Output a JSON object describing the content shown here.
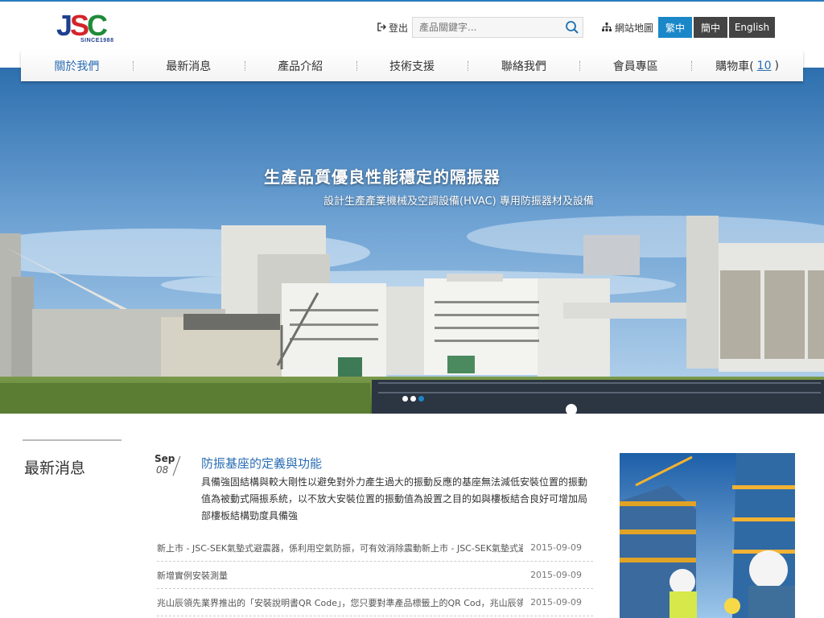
{
  "header": {
    "logo_text": "JSC",
    "logo_since": "SINCE1988",
    "login_label": "登出",
    "search_placeholder": "產品關鍵字...",
    "sitemap_label": "網站地圖",
    "lang": {
      "tc": "繁中",
      "sc": "簡中",
      "en": "English"
    }
  },
  "nav": {
    "items": [
      "關於我們",
      "最新消息",
      "產品介紹",
      "技術支援",
      "聯絡我們",
      "會員專區"
    ],
    "cart_label": "購物車(",
    "cart_count": "10",
    "cart_close": ")"
  },
  "hero": {
    "title": "生產品質優良性能穩定的隔振器",
    "subtitle": "設計生產產業機械及空調設備(HVAC) 專用防振器材及設備"
  },
  "news": {
    "heading": "最新消息",
    "featured": {
      "month": "Sep",
      "day": "08",
      "title": "防振基座的定義與功能",
      "body": "具備強固結構與較大剛性以避免對外力產生過大的振動反應的基座無法減低安裝位置的振動值為被動式隔振系統，以不放大安裝位置的振動值為設置之目的如與樓板結合良好可增加局部樓板結構勁度具備強"
    },
    "items": [
      {
        "title": "新上市 - JSC-SEK氣墊式避震器，係利用空氣防振，可有效消除震動新上市 - JSC-SEK氣墊式避震…",
        "date": "2015-09-09"
      },
      {
        "title": "新增實例安裝測量",
        "date": "2015-09-09"
      },
      {
        "title": "兆山辰領先業界推出的「安裝說明書QR Code」，您只要對準產品標籤上的QR Cod，兆山辰領先…",
        "date": "2015-09-09"
      }
    ]
  },
  "colors": {
    "accent": "#1a87c9",
    "link": "#2a6db3",
    "dark_btn": "#444444"
  }
}
